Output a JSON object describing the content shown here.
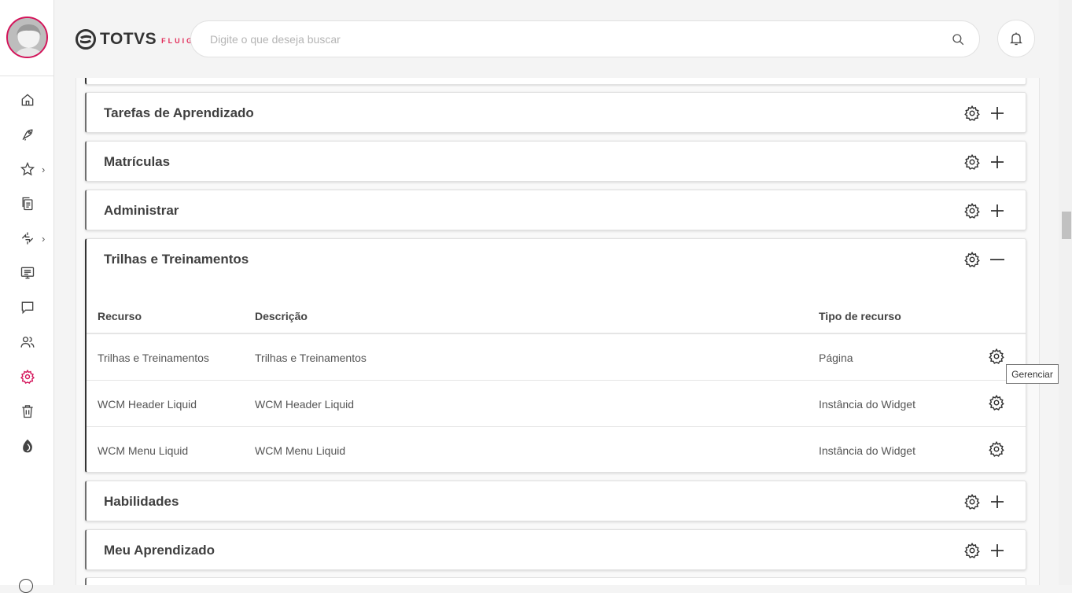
{
  "app": {
    "logo_text": "TOTVS",
    "logo_subtext": "FLUIG"
  },
  "search": {
    "placeholder": "Digite o que deseja buscar"
  },
  "sidebar": {
    "items": [
      {
        "icon": "home-icon"
      },
      {
        "icon": "rocket-icon"
      },
      {
        "icon": "star-icon",
        "has_submenu": true
      },
      {
        "icon": "documents-icon"
      },
      {
        "icon": "workflow-icon",
        "has_submenu": true
      },
      {
        "icon": "presentation-icon"
      },
      {
        "icon": "chat-icon"
      },
      {
        "icon": "users-icon"
      },
      {
        "icon": "gear-icon",
        "active": true
      },
      {
        "icon": "trash-icon"
      },
      {
        "icon": "fluig-drop-icon"
      }
    ],
    "active_color": "#d4145a"
  },
  "panels": [
    {
      "title": "Tarefas de Aprendizado",
      "expanded": false
    },
    {
      "title": "Matrículas",
      "expanded": false
    },
    {
      "title": "Administrar",
      "expanded": false
    },
    {
      "title": "Trilhas e Treinamentos",
      "expanded": true,
      "columns": [
        "Recurso",
        "Descrição",
        "Tipo de recurso"
      ],
      "rows": [
        {
          "resource": "Trilhas e Treinamentos",
          "description": "Trilhas e Treinamentos",
          "type": "Página"
        },
        {
          "resource": "WCM Header Liquid",
          "description": "WCM Header Liquid",
          "type": "Instância do Widget"
        },
        {
          "resource": "WCM Menu Liquid",
          "description": "WCM Menu Liquid",
          "type": "Instância do Widget"
        }
      ]
    },
    {
      "title": "Habilidades",
      "expanded": false
    },
    {
      "title": "Meu Aprendizado",
      "expanded": false
    }
  ],
  "tooltip": {
    "text": "Gerenciar"
  },
  "colors": {
    "brand": "#e22d5a",
    "avatar_border": "#d4145a"
  }
}
